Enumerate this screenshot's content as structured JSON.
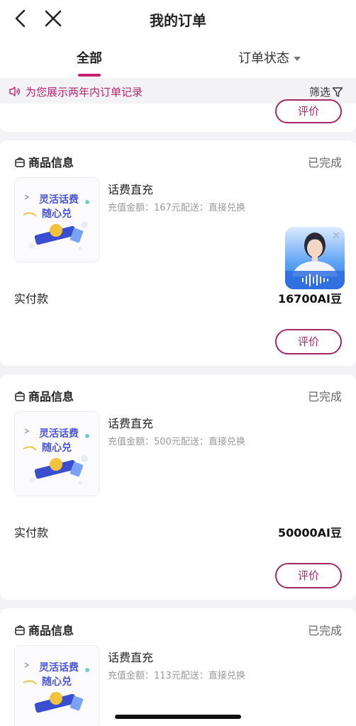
{
  "nav": {
    "title": "我的订单",
    "back_icon": "chevron-left-icon",
    "close_icon": "close-icon"
  },
  "tabs": {
    "all": "全部",
    "status": "订单状态"
  },
  "notice": {
    "text": "为您展示两年内订单记录",
    "filter": "筛选"
  },
  "colors": {
    "accent": "#c4206f",
    "accent_text": "#b4286d",
    "product_blue": "#4a55d6"
  },
  "prev_card": {
    "review_label": "评价"
  },
  "orders": [
    {
      "header": "商品信息",
      "status": "已完成",
      "thumb_line1": "灵活话费",
      "thumb_line2": "随心兑",
      "product": "话费直充",
      "desc": "充值金额：167元配送：直接兑换",
      "paid_label": "实付款",
      "amount": "16700AI豆",
      "review_label": "评价"
    },
    {
      "header": "商品信息",
      "status": "已完成",
      "thumb_line1": "灵活话费",
      "thumb_line2": "随心兑",
      "product": "话费直充",
      "desc": "充值金额：500元配送：直接兑换",
      "paid_label": "实付款",
      "amount": "50000AI豆",
      "review_label": "评价"
    },
    {
      "header": "商品信息",
      "status": "已完成",
      "thumb_line1": "灵活话费",
      "thumb_line2": "随心兑",
      "product": "话费直充",
      "desc": "充值金额：113元配送：直接兑换"
    }
  ]
}
